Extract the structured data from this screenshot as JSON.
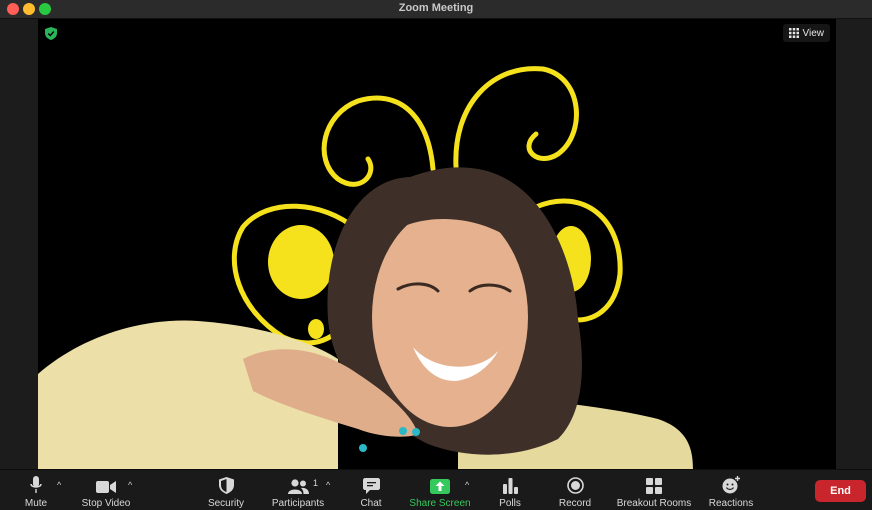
{
  "window": {
    "title": "Zoom Meeting"
  },
  "video": {
    "view_label": "View"
  },
  "toolbar": {
    "mute": "Mute",
    "stop_video": "Stop Video",
    "security": "Security",
    "participants": "Participants",
    "participant_count": "1",
    "chat": "Chat",
    "share_screen": "Share Screen",
    "polls": "Polls",
    "record": "Record",
    "breakout_rooms": "Breakout Rooms",
    "reactions": "Reactions",
    "end": "End"
  },
  "colors": {
    "share_green": "#35c95d",
    "end_red": "#c8262c",
    "doodle_yellow": "#f5e21c"
  }
}
